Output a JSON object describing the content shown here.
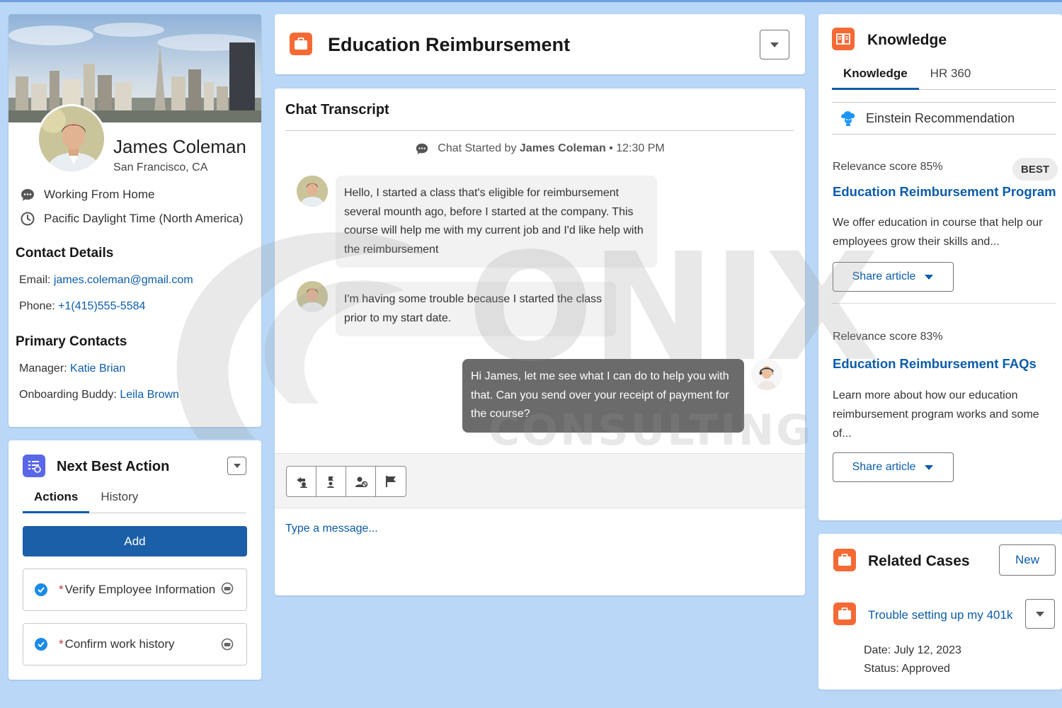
{
  "profile": {
    "name": "James Coleman",
    "location": "San Francisco, CA",
    "status": "Working From Home",
    "timezone": "Pacific Daylight Time (North America)",
    "contact_heading": "Contact Details",
    "email_label": "Email:",
    "email": "james.coleman@gmail.com",
    "phone_label": "Phone:",
    "phone": "+1(415)555-5584",
    "primary_heading": "Primary Contacts",
    "manager_label": "Manager:",
    "manager": "Katie Brian",
    "buddy_label": "Onboarding Buddy:",
    "buddy": "Leila Brown"
  },
  "nba": {
    "title": "Next Best Action",
    "tabs": [
      "Actions",
      "History"
    ],
    "add_label": "Add",
    "items": [
      {
        "label": "Verify Employee Information",
        "required": "*"
      },
      {
        "label": "Confirm work history",
        "required": "*"
      }
    ]
  },
  "header": {
    "title": "Education Reimbursement"
  },
  "chat": {
    "title": "Chat Transcript",
    "started_prefix": "Chat Started by",
    "started_by": "James Coleman",
    "started_time": "• 12:30 PM",
    "messages": [
      {
        "from": "customer",
        "text": "Hello, I started a class that's eligible for reimbursement several mounth ago, before I started at the company. This course will help me with my current job and I'd like help with the reimbursement"
      },
      {
        "from": "customer",
        "text": "I'm having some trouble because I started the class prior to my start date."
      },
      {
        "from": "agent",
        "text": "Hi James, let me see what I can do to help you with that. Can you send over your receipt of payment for the course?"
      }
    ],
    "input_placeholder": "Type a message..."
  },
  "knowledge": {
    "title": "Knowledge",
    "tabs": [
      "Knowledge",
      "HR 360"
    ],
    "einstein": "Einstein Recommendation",
    "articles": [
      {
        "score": "Relevance score 85%",
        "badge": "BEST",
        "title": "Education Reimbursement Program",
        "desc": "We offer education in course that help our employees grow their skills and...",
        "share": "Share article"
      },
      {
        "score": "Relevance score 83%",
        "title": "Education Reimbursement FAQs",
        "desc": "Learn more about how our education reimbursement program works and some of...",
        "share": "Share article"
      }
    ]
  },
  "related": {
    "title": "Related Cases",
    "new_label": "New",
    "case_title": "Trouble setting up my 401k",
    "date": "Date: July 12, 2023",
    "status": "Status: Approved"
  },
  "watermark": {
    "brand": "ONIX",
    "sub": "CONSULTING"
  },
  "colors": {
    "background": "#b9d7f6",
    "brand_blue": "#0b5cab",
    "add_button": "#1b5fa8",
    "orange_icon": "#f46a35",
    "nba_icon": "#5a67e8",
    "agent_bubble": "#6b6b6b",
    "customer_bubble": "#f2f2f2"
  }
}
